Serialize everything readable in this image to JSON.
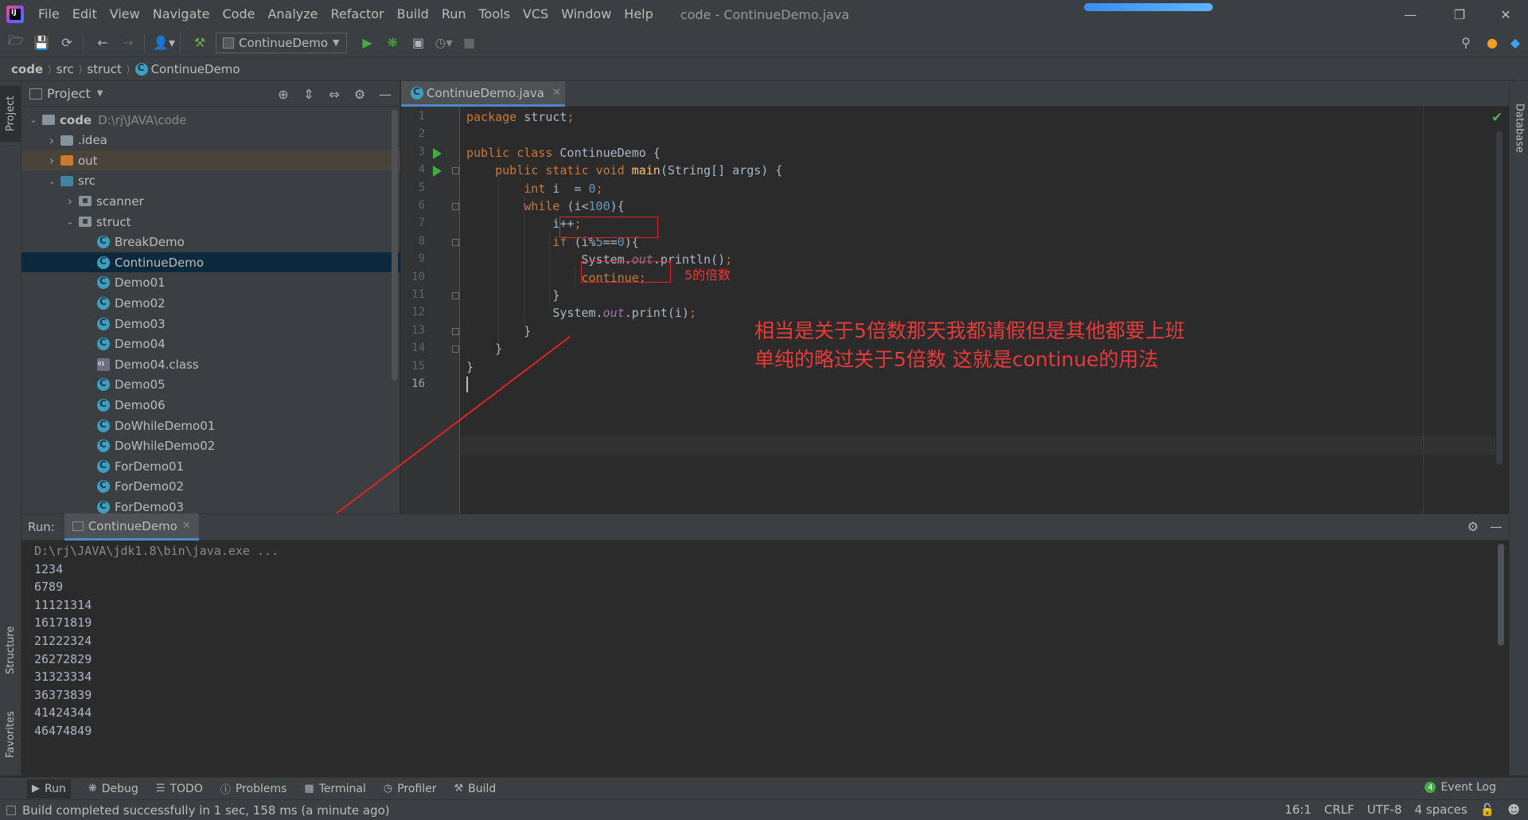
{
  "menubar": {
    "items": [
      "File",
      "Edit",
      "View",
      "Navigate",
      "Code",
      "Analyze",
      "Refactor",
      "Build",
      "Run",
      "Tools",
      "VCS",
      "Window",
      "Help"
    ],
    "window_title": "code - ContinueDemo.java",
    "logo_text": "IJ",
    "progress": 1.0
  },
  "toolbar": {
    "run_config": "ContinueDemo"
  },
  "breadcrumb": [
    "code",
    "src",
    "struct",
    "ContinueDemo"
  ],
  "left_strip": {
    "project": "Project",
    "structure": "Structure",
    "favorites": "Favorites"
  },
  "right_strip": {
    "database": "Database"
  },
  "project_panel": {
    "title": "Project",
    "tree": [
      {
        "label": "code",
        "path": "D:\\rj\\JAVA\\code",
        "type": "module",
        "depth": 0,
        "expanded": true
      },
      {
        "label": ".idea",
        "type": "folder",
        "depth": 1,
        "expanded": false
      },
      {
        "label": "out",
        "type": "folder-excluded",
        "depth": 1,
        "expanded": false
      },
      {
        "label": "src",
        "type": "folder-source",
        "depth": 1,
        "expanded": true
      },
      {
        "label": "scanner",
        "type": "package",
        "depth": 2,
        "expanded": false
      },
      {
        "label": "struct",
        "type": "package",
        "depth": 2,
        "expanded": true
      },
      {
        "label": "BreakDemo",
        "type": "class",
        "depth": 3
      },
      {
        "label": "ContinueDemo",
        "type": "class",
        "depth": 3,
        "selected": true
      },
      {
        "label": "Demo01",
        "type": "class",
        "depth": 3
      },
      {
        "label": "Demo02",
        "type": "class",
        "depth": 3
      },
      {
        "label": "Demo03",
        "type": "class",
        "depth": 3
      },
      {
        "label": "Demo04",
        "type": "class",
        "depth": 3
      },
      {
        "label": "Demo04.class",
        "type": "classfile",
        "depth": 3
      },
      {
        "label": "Demo05",
        "type": "class",
        "depth": 3
      },
      {
        "label": "Demo06",
        "type": "class",
        "depth": 3
      },
      {
        "label": "DoWhileDemo01",
        "type": "class",
        "depth": 3
      },
      {
        "label": "DoWhileDemo02",
        "type": "class",
        "depth": 3
      },
      {
        "label": "ForDemo01",
        "type": "class",
        "depth": 3
      },
      {
        "label": "ForDemo02",
        "type": "class",
        "depth": 3
      },
      {
        "label": "ForDemo03",
        "type": "class",
        "depth": 3
      }
    ]
  },
  "editor": {
    "tab": "ContinueDemo.java",
    "line_numbers": [
      "1",
      "2",
      "3",
      "4",
      "5",
      "6",
      "7",
      "8",
      "9",
      "10",
      "11",
      "12",
      "13",
      "14",
      "15",
      "16"
    ],
    "current_line": 16,
    "lines": [
      [
        {
          "t": "package ",
          "c": "kw"
        },
        {
          "t": "struct",
          "c": ""
        },
        {
          "t": ";",
          "c": "kw"
        }
      ],
      [],
      [
        {
          "t": "public class ",
          "c": "kw"
        },
        {
          "t": "ContinueDemo {",
          "c": ""
        }
      ],
      [
        {
          "t": "    public static void ",
          "c": "kw"
        },
        {
          "t": "main",
          "c": "fn"
        },
        {
          "t": "(String[] args) {",
          "c": ""
        }
      ],
      [
        {
          "t": "        int ",
          "c": "kw"
        },
        {
          "t": "i  = ",
          "c": ""
        },
        {
          "t": "0",
          "c": "num"
        },
        {
          "t": ";",
          "c": "kw"
        }
      ],
      [
        {
          "t": "        while ",
          "c": "kw"
        },
        {
          "t": "(i<",
          "c": ""
        },
        {
          "t": "100",
          "c": "num"
        },
        {
          "t": "){",
          "c": ""
        }
      ],
      [
        {
          "t": "            i++",
          "c": ""
        },
        {
          "t": ";",
          "c": "kw"
        }
      ],
      [
        {
          "t": "            if ",
          "c": "kw"
        },
        {
          "t": "(i%",
          "c": ""
        },
        {
          "t": "5",
          "c": "num"
        },
        {
          "t": "==",
          "c": ""
        },
        {
          "t": "0",
          "c": "num"
        },
        {
          "t": "){",
          "c": ""
        }
      ],
      [
        {
          "t": "                System.",
          "c": ""
        },
        {
          "t": "out",
          "c": "field"
        },
        {
          "t": ".println()",
          "c": ""
        },
        {
          "t": ";",
          "c": "kw"
        }
      ],
      [
        {
          "t": "                continue;",
          "c": "kw"
        }
      ],
      [
        {
          "t": "            }",
          "c": ""
        }
      ],
      [
        {
          "t": "            System.",
          "c": ""
        },
        {
          "t": "out",
          "c": "field"
        },
        {
          "t": ".print(i)",
          "c": ""
        },
        {
          "t": ";",
          "c": "kw"
        }
      ],
      [
        {
          "t": "        }",
          "c": ""
        }
      ],
      [
        {
          "t": "    }",
          "c": ""
        }
      ],
      [
        {
          "t": "}",
          "c": ""
        }
      ],
      []
    ]
  },
  "annotations": {
    "label_5x": "5的倍数",
    "note_line1": "相当是关于5倍数那天我都请假但是其他都要上班",
    "note_line2": "单纯的略过关于5倍数 这就是continue的用法",
    "color": "#e02424"
  },
  "run_panel": {
    "label": "Run:",
    "tab": "ContinueDemo",
    "output": [
      "D:\\rj\\JAVA\\jdk1.8\\bin\\java.exe ...",
      "1234",
      "6789",
      "11121314",
      "16171819",
      "21222324",
      "26272829",
      "31323334",
      "36373839",
      "41424344",
      "46474849"
    ]
  },
  "tool_tabs": {
    "items": [
      "Run",
      "Debug",
      "TODO",
      "Problems",
      "Terminal",
      "Profiler",
      "Build"
    ],
    "event_log": "Event Log"
  },
  "statusbar": {
    "message": "Build completed successfully in 1 sec, 158 ms (a minute ago)",
    "position": "16:1",
    "line_sep": "CRLF",
    "encoding": "UTF-8",
    "indent": "4 spaces"
  }
}
